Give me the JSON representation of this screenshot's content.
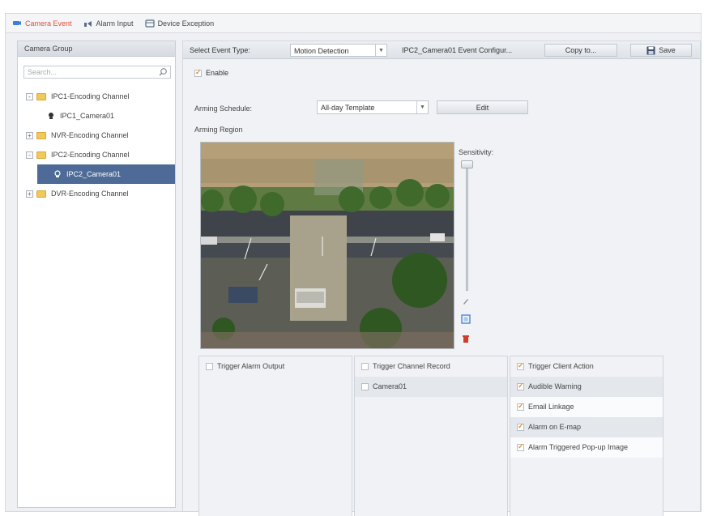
{
  "tabs": [
    {
      "label": "Camera Event",
      "icon": "camera-event-icon",
      "active": true
    },
    {
      "label": "Alarm Input",
      "icon": "alarm-input-icon",
      "active": false
    },
    {
      "label": "Device Exception",
      "icon": "device-exception-icon",
      "active": false
    }
  ],
  "left_panel": {
    "title": "Camera Group",
    "search_placeholder": "Search...",
    "tree": [
      {
        "label": "IPC1-Encoding Channel",
        "expand": "-",
        "type": "group"
      },
      {
        "label": "IPC1_Camera01",
        "type": "camera"
      },
      {
        "label": "NVR-Encoding Channel",
        "expand": "+",
        "type": "group"
      },
      {
        "label": "IPC2-Encoding Channel",
        "expand": "-",
        "type": "group"
      },
      {
        "label": "IPC2_Camera01",
        "type": "camera",
        "selected": true
      },
      {
        "label": "DVR-Encoding Channel",
        "expand": "+",
        "type": "group"
      }
    ]
  },
  "toolbar": {
    "event_type_label": "Select Event Type:",
    "event_type_value": "Motion Detection",
    "config_title": "IPC2_Camera01 Event Configur...",
    "copy_label": "Copy to...",
    "save_label": "Save"
  },
  "config": {
    "enable_label": "Enable",
    "enable_checked": true,
    "schedule_label": "Arming Schedule:",
    "schedule_value": "All-day Template",
    "edit_label": "Edit",
    "region_label": "Arming Region",
    "sensitivity_label": "Sensitivity:",
    "sensitivity_level": 1.0
  },
  "linkage": {
    "alarm_output": [
      {
        "label": "Trigger Alarm Output",
        "checked": false
      }
    ],
    "channel_record": [
      {
        "label": "Trigger Channel Record",
        "checked": false
      },
      {
        "label": "Camera01",
        "checked": false
      }
    ],
    "actions": [
      {
        "label": "Trigger Client Action",
        "checked": true
      },
      {
        "label": "Audible Warning",
        "checked": true
      },
      {
        "label": "Email Linkage",
        "checked": true
      },
      {
        "label": "Alarm on E-map",
        "checked": true
      },
      {
        "label": "Alarm Triggered Pop-up Image",
        "checked": true
      }
    ]
  },
  "colors": {
    "accent": "#e0503c",
    "selection": "#4d6b96",
    "check": "#e0943a"
  }
}
